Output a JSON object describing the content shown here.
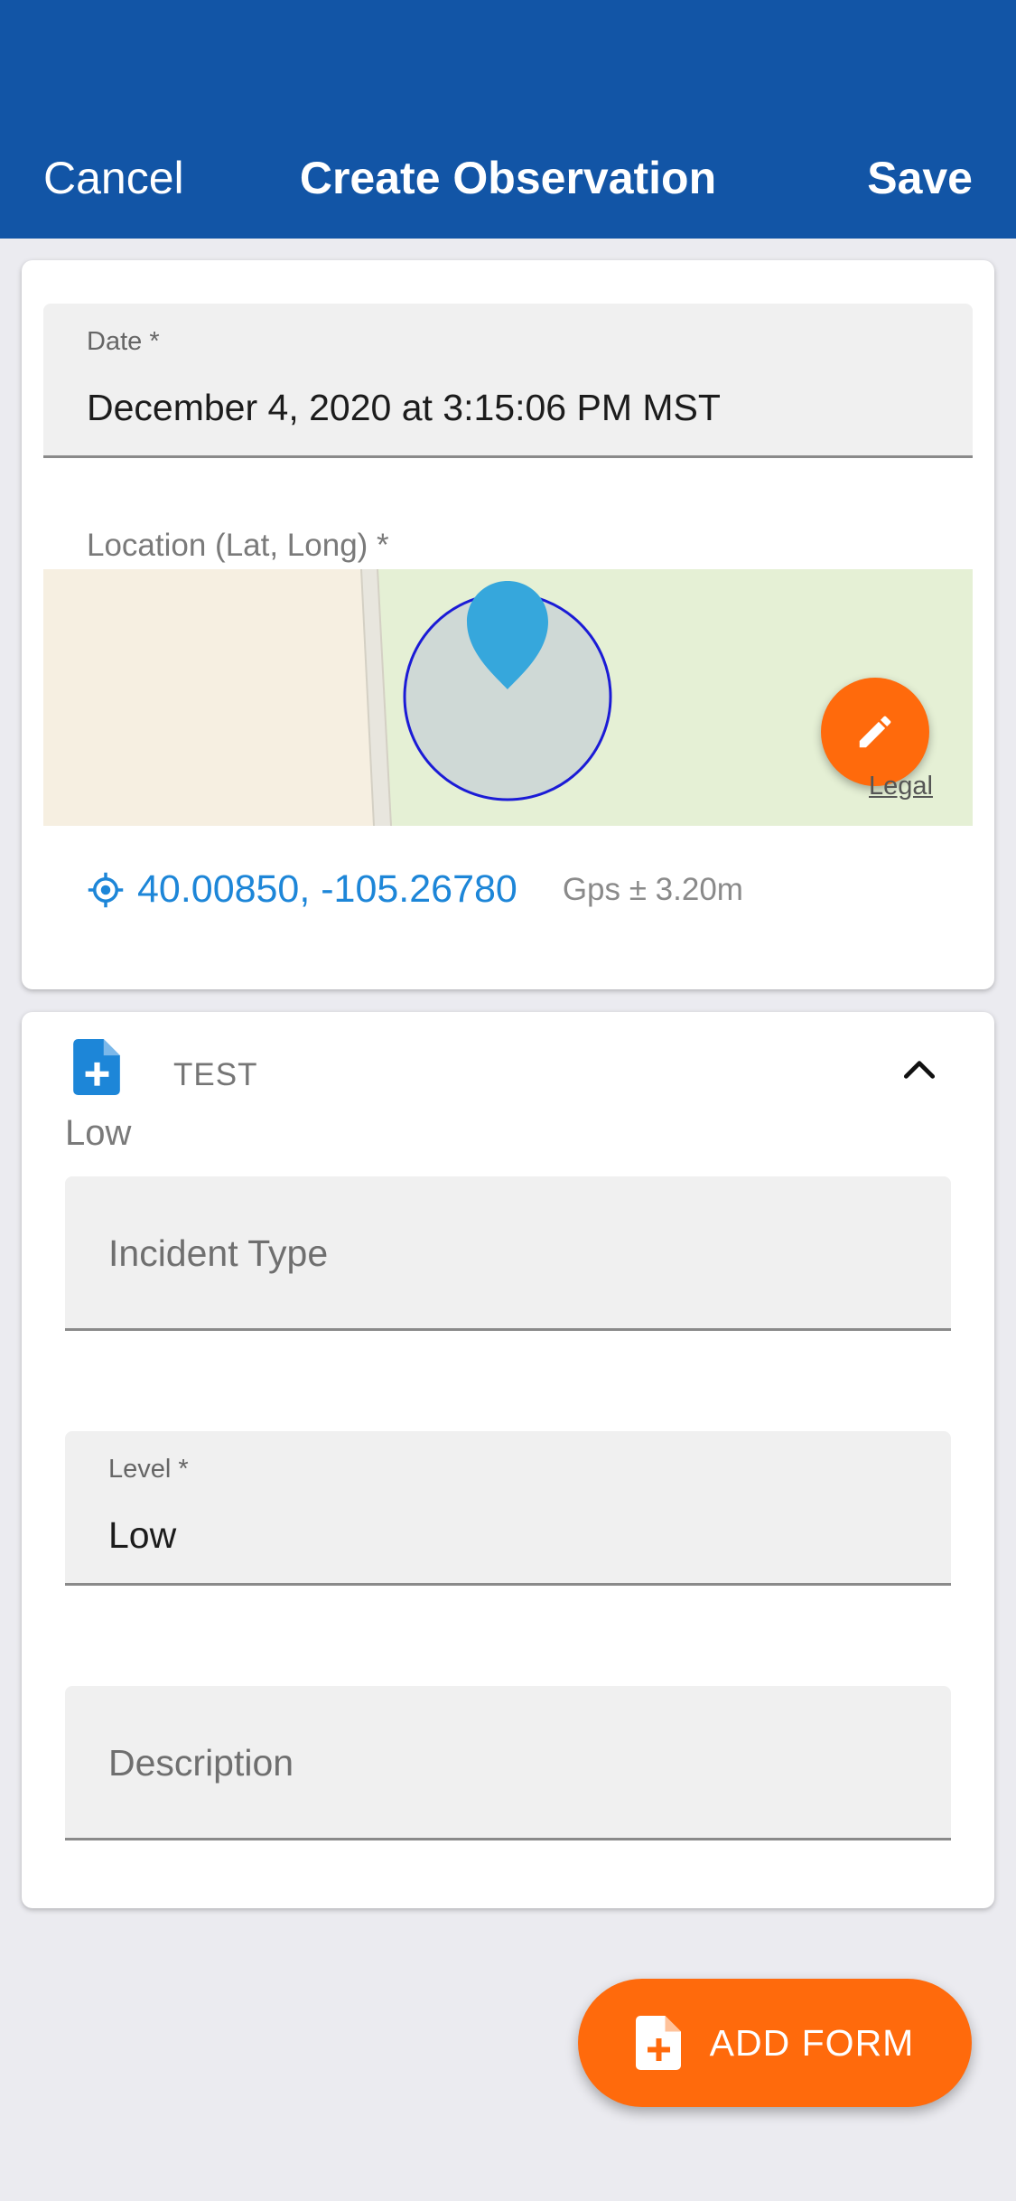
{
  "nav": {
    "cancel_label": "Cancel",
    "title": "Create Observation",
    "save_label": "Save",
    "background": "#1255a6"
  },
  "date_field": {
    "label": "Date *",
    "value": "December 4, 2020 at 3:15:06 PM MST"
  },
  "location": {
    "label": "Location (Lat, Long) *",
    "coordinates": "40.00850, -105.26780",
    "accuracy": "Gps ± 3.20m",
    "legal_label": "Legal",
    "icons": {
      "locate": "crosshair-icon",
      "edit": "pencil-icon",
      "pin": "map-pin-icon"
    }
  },
  "form": {
    "name": "TEST",
    "subtitle": "Low",
    "icons": {
      "form": "file-plus-icon",
      "collapse": "chevron-up-icon"
    },
    "fields": {
      "incident_type": {
        "placeholder": "Incident Type"
      },
      "level": {
        "label": "Level *",
        "value": "Low"
      },
      "description": {
        "placeholder": "Description"
      }
    }
  },
  "add_form_button": {
    "label": "ADD FORM",
    "icon": "file-plus-icon",
    "color": "#ff6a0c"
  }
}
